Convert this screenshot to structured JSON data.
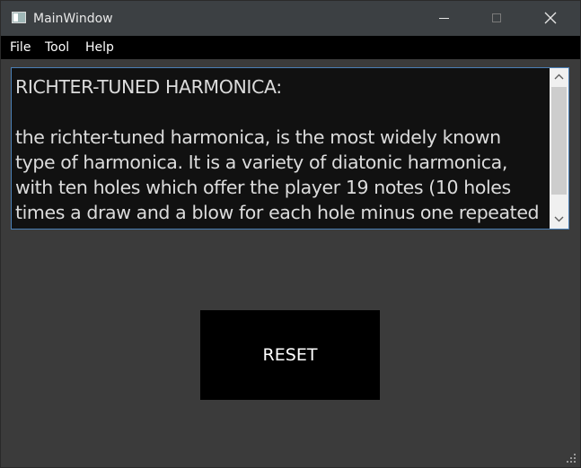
{
  "window": {
    "title": "MainWindow",
    "controls": {
      "minimize": "minimize-icon",
      "maximize": "maximize-icon",
      "close": "close-icon"
    }
  },
  "menubar": {
    "items": [
      {
        "label": "File"
      },
      {
        "label": "Tool"
      },
      {
        "label": "Help"
      }
    ]
  },
  "textarea": {
    "value": "RICHTER-TUNED HARMONICA:\n\nthe richter-tuned harmonica, is the most widely known type of harmonica. It is a variety of diatonic harmonica, with ten holes which offer the player 19 notes (10 holes times a draw and a blow for each hole minus one repeated note) in a three octave range."
  },
  "reset_button": {
    "label": "RESET"
  },
  "colors": {
    "window_bg": "#3b3b3b",
    "titlebar_bg": "#3c4043",
    "menubar_bg": "#000000",
    "textarea_bg": "#111111",
    "textarea_border": "#4a7fb5",
    "button_bg": "#000000"
  }
}
